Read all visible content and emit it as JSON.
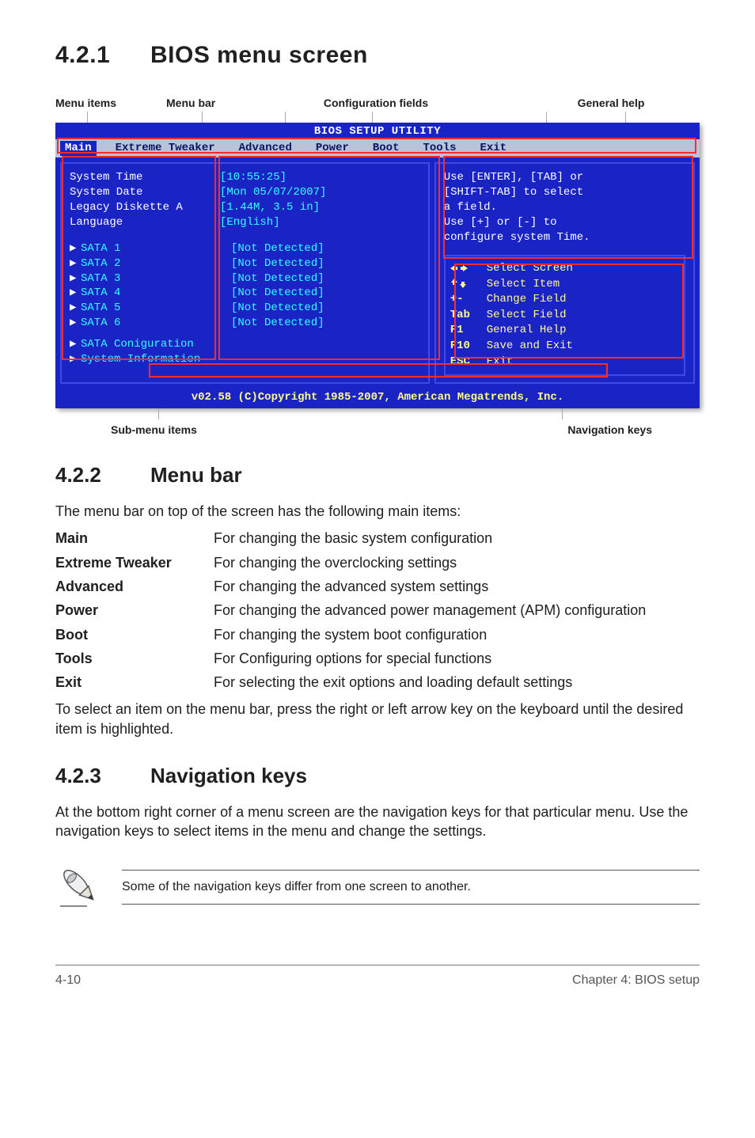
{
  "sections": {
    "s421": {
      "num": "4.2.1",
      "title": "BIOS menu screen"
    },
    "s422": {
      "num": "4.2.2",
      "title": "Menu bar",
      "intro": "The menu bar on top of the screen has the following main items:"
    },
    "s423": {
      "num": "4.2.3",
      "title": "Navigation keys",
      "para": "At the bottom right corner of a menu screen are the navigation keys for that particular menu. Use the navigation keys to select items in the menu and change the settings."
    }
  },
  "callouts": {
    "menu_items": "Menu items",
    "menu_bar": "Menu bar",
    "config_fields": "Configuration fields",
    "general_help": "General help",
    "sub_menu_items": "Sub-menu items",
    "nav_keys": "Navigation keys"
  },
  "bios": {
    "title": "BIOS SETUP UTILITY",
    "tabs": [
      "Main",
      "Extreme Tweaker",
      "Advanced",
      "Power",
      "Boot",
      "Tools",
      "Exit"
    ],
    "fields": [
      {
        "k": "System Time",
        "v": "[10:55:25]"
      },
      {
        "k": "System Date",
        "v": "[Mon 05/07/2007]"
      },
      {
        "k": "Legacy Diskette A",
        "v": "[1.44M, 3.5 in]"
      },
      {
        "k": "Language",
        "v": "[English]"
      }
    ],
    "sata": [
      {
        "k": "SATA 1",
        "v": "[Not Detected]"
      },
      {
        "k": "SATA 2",
        "v": "[Not Detected]"
      },
      {
        "k": "SATA 3",
        "v": "[Not Detected]"
      },
      {
        "k": "SATA 4",
        "v": "[Not Detected]"
      },
      {
        "k": "SATA 5",
        "v": "[Not Detected]"
      },
      {
        "k": "SATA 6",
        "v": "[Not Detected]"
      }
    ],
    "submenus": [
      "SATA Coniguration",
      "System Information"
    ],
    "help_lines": [
      "Use [ENTER], [TAB] or",
      "[SHIFT-TAB] to select",
      "a field.",
      "",
      "Use [+] or [-] to",
      "configure system Time."
    ],
    "navkeys": [
      {
        "key": "↔",
        "act": "Select Screen"
      },
      {
        "key": "↑↓",
        "act": "Select Item"
      },
      {
        "key": "+-",
        "act": "Change Field"
      },
      {
        "key": "Tab",
        "act": "Select Field"
      },
      {
        "key": "F1",
        "act": "General Help"
      },
      {
        "key": "F10",
        "act": "Save and Exit"
      },
      {
        "key": "ESC",
        "act": "Exit"
      }
    ],
    "footer": "v02.58 (C)Copyright 1985-2007, American Megatrends, Inc."
  },
  "definitions": [
    {
      "term": "Main",
      "desc": "For changing the basic system configuration"
    },
    {
      "term": "Extreme Tweaker",
      "desc": "For changing the overclocking settings"
    },
    {
      "term": "Advanced",
      "desc": "For changing the advanced system settings"
    },
    {
      "term": "Power",
      "desc": "For changing the advanced power management (APM) configuration"
    },
    {
      "term": "Boot",
      "desc": "For changing the system boot configuration"
    },
    {
      "term": "Tools",
      "desc": "For Configuring options for special functions"
    },
    {
      "term": "Exit",
      "desc": "For selecting the exit options and loading default settings"
    }
  ],
  "after_defs": "To select an item on the menu bar, press the right or left arrow key on the keyboard until the desired item is highlighted.",
  "note": "Some of the navigation keys differ from one screen to another.",
  "footer": {
    "left": "4-10",
    "right": "Chapter 4: BIOS setup"
  }
}
